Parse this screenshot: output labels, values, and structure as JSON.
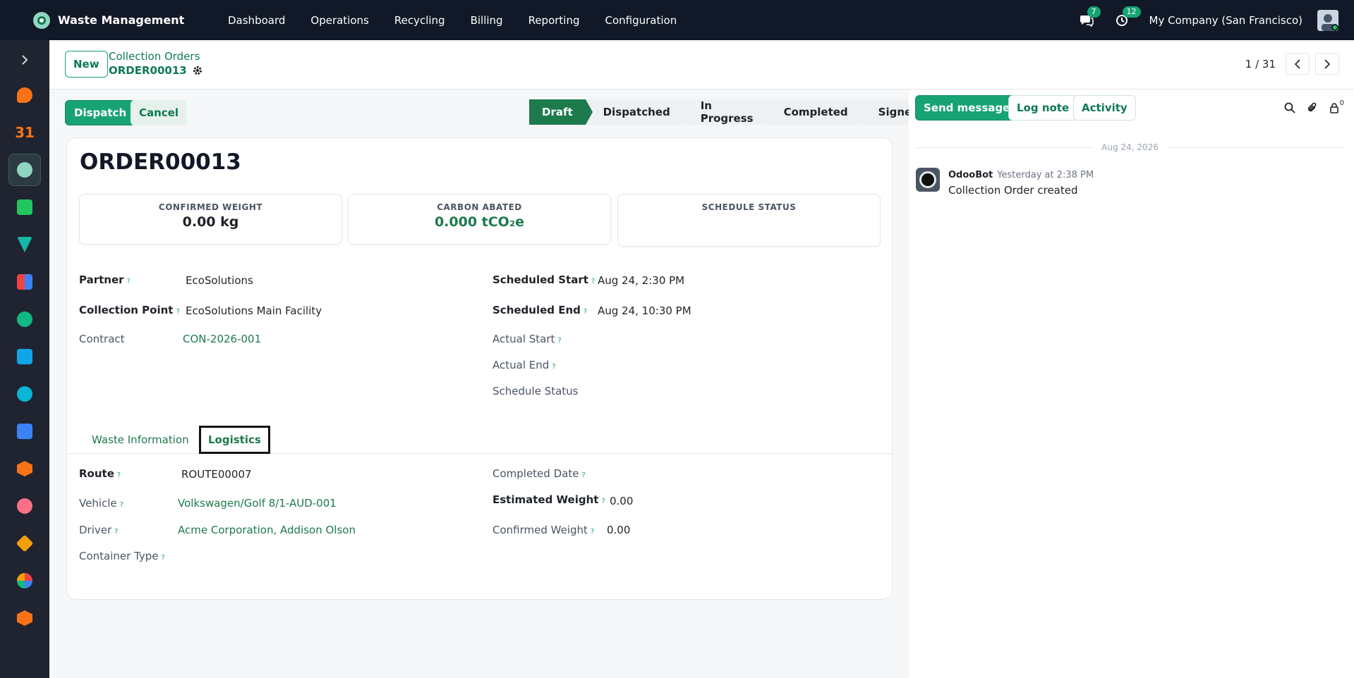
{
  "app": {
    "name": "Waste Management",
    "menu": [
      "Dashboard",
      "Operations",
      "Recycling",
      "Billing",
      "Reporting",
      "Configuration"
    ],
    "messages_count": "7",
    "activities_count": "12",
    "company": "My Company (San Francisco)"
  },
  "breadcrumb": {
    "new_label": "New",
    "parent": "Collection Orders",
    "current": "ORDER00013"
  },
  "pager": {
    "value": "1 / 31"
  },
  "actions": {
    "dispatch": "Dispatch",
    "cancel": "Cancel"
  },
  "statusbar": {
    "stages": [
      "Draft",
      "Dispatched",
      "In Progress",
      "Completed",
      "Signed"
    ],
    "active": "Draft"
  },
  "record": {
    "title": "ORDER00013",
    "stats": [
      {
        "label": "CONFIRMED WEIGHT",
        "value": "0.00 kg"
      },
      {
        "label": "CARBON ABATED",
        "value": "0.000 tCO₂e"
      },
      {
        "label": "SCHEDULE STATUS",
        "value": ""
      }
    ],
    "left_fields": [
      {
        "label": "Partner",
        "value": "EcoSolutions"
      },
      {
        "label": "Collection Point",
        "value": "EcoSolutions Main Facility"
      },
      {
        "label": "Contract",
        "value": "CON-2026-001"
      }
    ],
    "right_fields": [
      {
        "label": "Scheduled Start",
        "value": "Aug 24, 2:30 PM"
      },
      {
        "label": "Scheduled End",
        "value": "Aug 24, 10:30 PM"
      },
      {
        "label": "Actual Start",
        "value": ""
      },
      {
        "label": "Actual End",
        "value": ""
      },
      {
        "label": "Schedule Status",
        "value": ""
      }
    ]
  },
  "tabs": [
    "Waste Information",
    "Logistics"
  ],
  "active_tab": "Logistics",
  "logistics": {
    "left": [
      {
        "label": "Route",
        "value": "ROUTE00007"
      },
      {
        "label": "Vehicle",
        "value": "Volkswagen/Golf 8/1-AUD-001"
      },
      {
        "label": "Driver",
        "value": "Acme Corporation, Addison Olson"
      },
      {
        "label": "Container Type",
        "value": ""
      }
    ],
    "right": [
      {
        "label": "Completed Date",
        "value": ""
      },
      {
        "label": "Estimated Weight",
        "value": "0.00"
      },
      {
        "label": "Confirmed Weight",
        "value": "0.00"
      }
    ]
  },
  "chatter": {
    "send_message": "Send message",
    "log_note": "Log note",
    "activity": "Activity",
    "followers_count": "0",
    "date_separator": "Aug 24, 2026",
    "messages": [
      {
        "author": "OdooBot",
        "time": "Yesterday at 2:38 PM",
        "body": "Collection Order created"
      }
    ]
  },
  "colors": {
    "accent": "#18a373",
    "topbar": "#111827",
    "link": "#1d7a4d"
  }
}
